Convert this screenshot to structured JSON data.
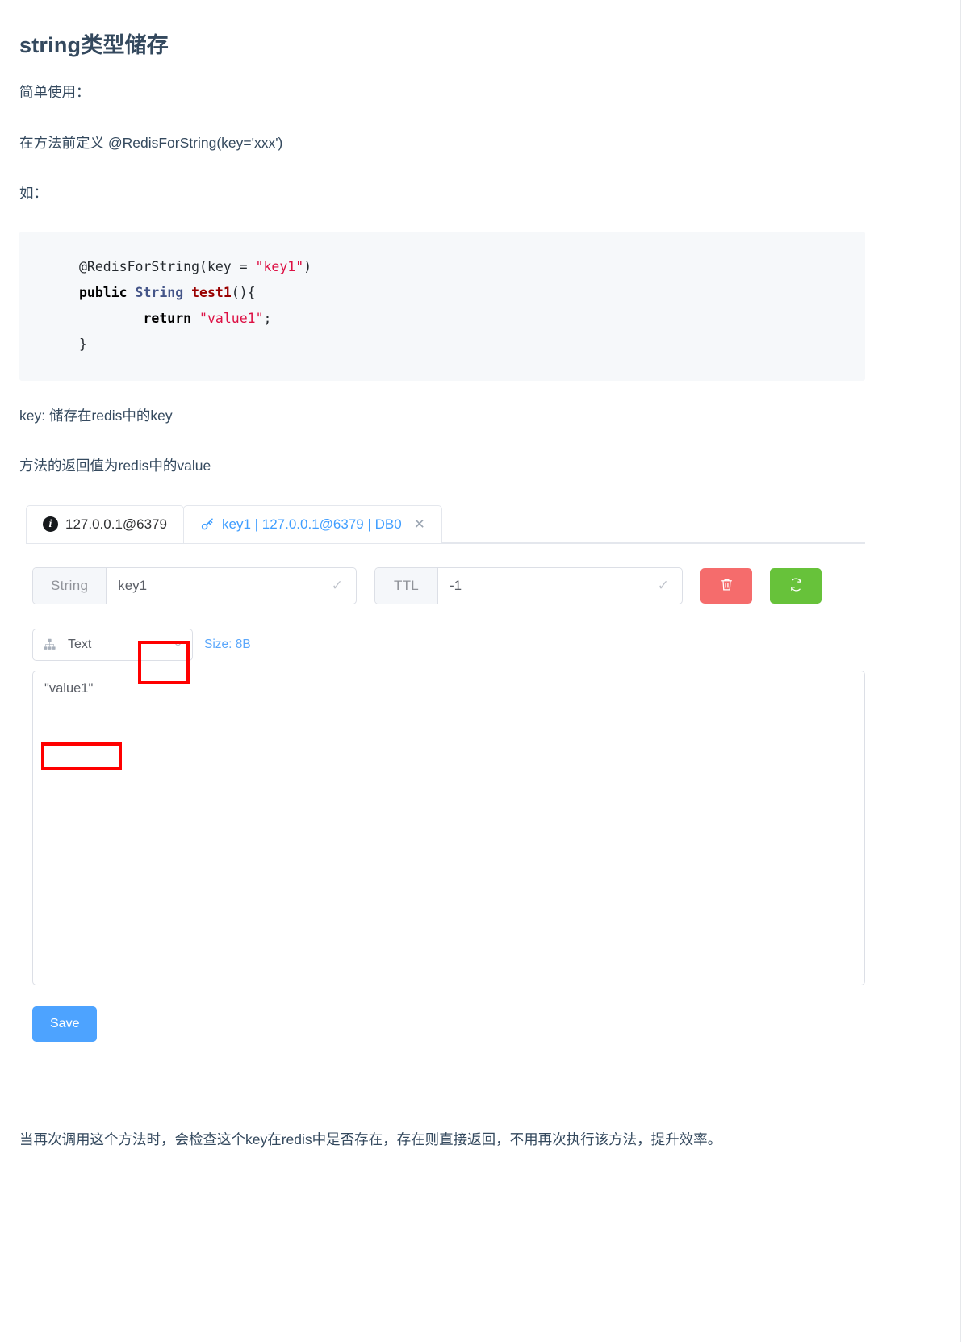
{
  "doc": {
    "title": "string类型储存",
    "intro": "简单使用：",
    "usage": " 在方法前定义 @RedisForString(key='xxx')",
    "example_label": "如：",
    "code": {
      "line1_annotation": "@RedisForString(key = ",
      "line1_string": "\"key1\"",
      "line1_close": ")",
      "line2_kw": "public",
      "line2_type": "String",
      "line2_fn": "test1",
      "line2_rest": "(){",
      "line3_kw": "return",
      "line3_string": "\"value1\"",
      "line3_semi": ";",
      "line4": "}"
    },
    "key_desc": "key: 储存在redis中的key",
    "return_desc": "方法的返回值为redis中的value",
    "footer_note": "当再次调用这个方法时，会检查这个key在redis中是否存在，存在则直接返回，不用再次执行该方法，提升效率。"
  },
  "redis_client": {
    "tabs": [
      {
        "id": "connection",
        "label": "127.0.0.1@6379",
        "icon": "info-icon",
        "active": false,
        "closable": false
      },
      {
        "id": "key-detail",
        "label": "key1 | 127.0.0.1@6379 | DB0",
        "icon": "key-icon",
        "active": true,
        "closable": true,
        "close_glyph": "✕"
      }
    ],
    "key_row": {
      "type_label": "String",
      "key_value": "key1",
      "key_check_glyph": "✓",
      "ttl_label": "TTL",
      "ttl_value": "-1",
      "ttl_check_glyph": "✓",
      "delete_button": "delete-key-button",
      "refresh_button": "refresh-key-button"
    },
    "view_row": {
      "format_value": "Text",
      "format_icon": "sitemap-icon",
      "chevron": "chevron-down-icon",
      "size_label": "Size: 8B"
    },
    "value_editor": {
      "value": "\"value1\""
    },
    "save_label": "Save"
  },
  "colors": {
    "accent_blue": "#409eff",
    "save_blue": "#4da3ff",
    "danger_red": "#f56c6c",
    "success_green": "#67c23a",
    "annotation_red": "#ff0000",
    "text": "#34495e",
    "code_bg": "#f6f8fa",
    "string_token": "#d14",
    "type_token": "#445588",
    "fn_token": "#990000",
    "size_blue": "#5aa7fb"
  }
}
